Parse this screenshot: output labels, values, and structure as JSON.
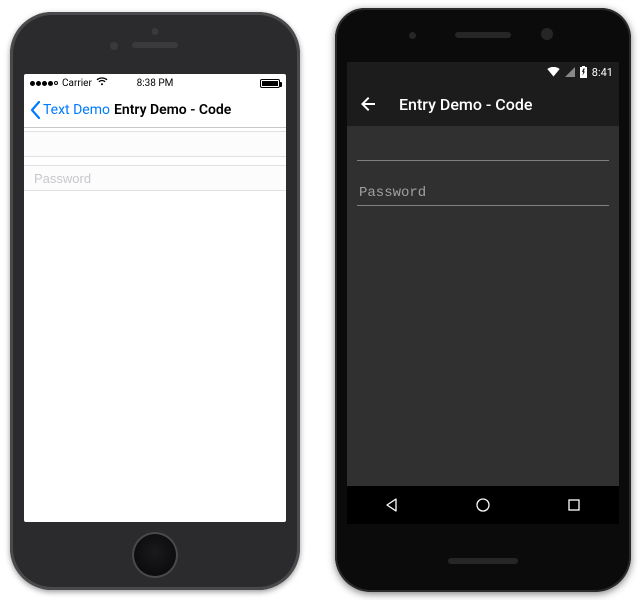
{
  "ios": {
    "status": {
      "carrier": "Carrier",
      "time": "8:38 PM"
    },
    "nav": {
      "back_label": "Text Demo",
      "title": "Entry Demo - Code"
    },
    "fields": {
      "text_placeholder": "",
      "password_placeholder": "Password"
    }
  },
  "android": {
    "status": {
      "time": "8:41"
    },
    "appbar": {
      "title": "Entry Demo - Code"
    },
    "fields": {
      "text_placeholder": "",
      "password_placeholder": "Password"
    }
  }
}
